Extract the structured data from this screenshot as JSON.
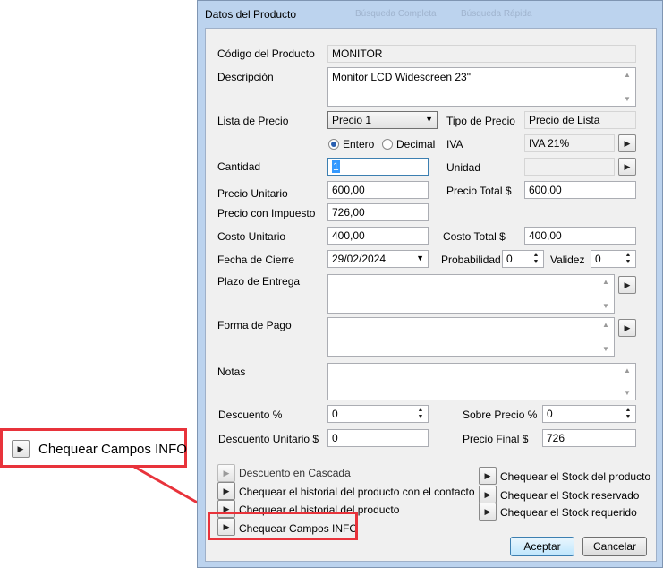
{
  "window": {
    "title": "Datos del Producto",
    "ghost_1": "Búsqueda Completa",
    "ghost_2": "Búsqueda Rápida"
  },
  "form": {
    "codigo": {
      "label": "Código del Producto",
      "value": "MONITOR"
    },
    "descripcion": {
      "label": "Descripción",
      "value": "Monitor LCD Widescreen 23\""
    },
    "lista_precio": {
      "label": "Lista de Precio",
      "value": "Precio 1"
    },
    "tipo_precio": {
      "label": "Tipo de Precio",
      "value": "Precio de Lista"
    },
    "radios": {
      "entero": "Entero",
      "decimal": "Decimal",
      "selected": "entero"
    },
    "iva": {
      "label": "IVA",
      "value": "IVA 21%"
    },
    "cantidad": {
      "label": "Cantidad",
      "value": "1"
    },
    "unidad": {
      "label": "Unidad",
      "value": ""
    },
    "precio_unitario": {
      "label": "Precio Unitario",
      "value": "600,00"
    },
    "precio_total": {
      "label": "Precio Total $",
      "value": "600,00"
    },
    "precio_impuesto": {
      "label": "Precio con Impuesto",
      "value": "726,00"
    },
    "costo_unitario": {
      "label": "Costo Unitario",
      "value": "400,00"
    },
    "costo_total": {
      "label": "Costo Total  $",
      "value": "400,00"
    },
    "fecha_cierre": {
      "label": "Fecha de Cierre",
      "value": "29/02/2024"
    },
    "probabilidad": {
      "label": "Probabilidad",
      "value": "0"
    },
    "validez": {
      "label": "Validez",
      "value": "0"
    },
    "plazo_entrega": {
      "label": "Plazo de Entrega",
      "value": ""
    },
    "forma_pago": {
      "label": "Forma de Pago",
      "value": ""
    },
    "notas": {
      "label": "Notas",
      "value": ""
    },
    "descuento": {
      "label": "Descuento %",
      "value": "0"
    },
    "sobre_precio": {
      "label": "Sobre Precio %",
      "value": "0"
    },
    "descuento_unitario": {
      "label": "Descuento Unitario $",
      "value": "0"
    },
    "precio_final": {
      "label": "Precio Final $",
      "value": "726"
    }
  },
  "actions_left": [
    "Descuento en Cascada",
    "Chequear el historial del producto con el contacto",
    "Chequear el historial del producto",
    "Chequear Campos INFO"
  ],
  "actions_right": [
    "Chequear el Stock del producto",
    "Chequear el Stock reservado",
    "Chequear el Stock requerido"
  ],
  "buttons": {
    "ok": "Aceptar",
    "cancel": "Cancelar"
  },
  "callout": {
    "label": "Chequear Campos INFO"
  },
  "colors": {
    "highlight": "#e8333b",
    "window_frame": "#bcd3ee"
  }
}
